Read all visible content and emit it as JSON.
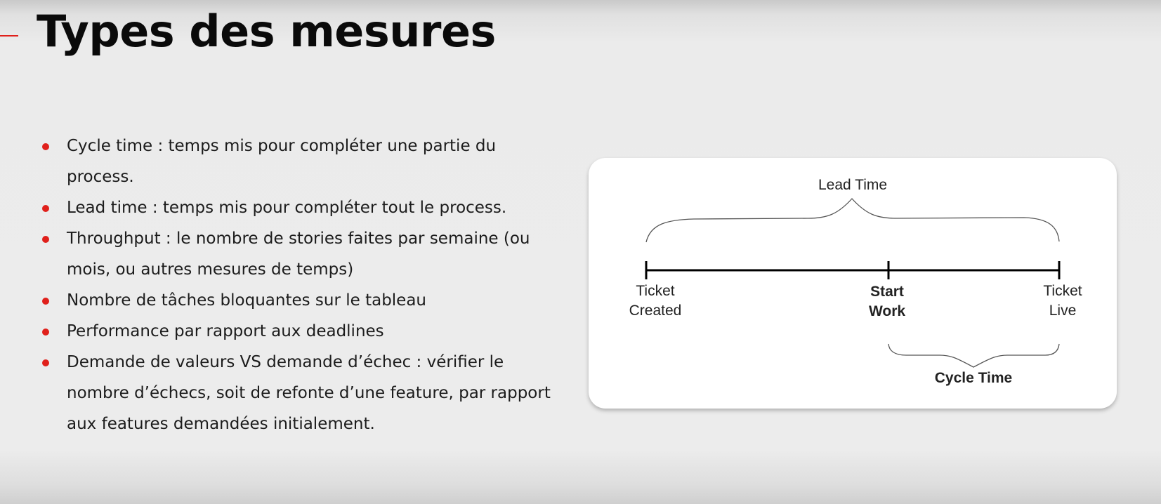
{
  "slide": {
    "title": "Types des mesures",
    "accent_color": "#e0201b"
  },
  "bullets": [
    "Cycle time : temps mis pour compléter une partie du process.",
    "Lead time : temps mis pour compléter tout le process.",
    "Throughput : le nombre de stories faites par semaine (ou mois, ou autres mesures de temps)",
    "Nombre de tâches bloquantes sur le tableau",
    "Performance par rapport aux deadlines",
    "Demande de valeurs VS demande d’échec : vérifier le nombre d’échecs, soit de refonte d’une feature, par rapport aux features demandées initialement."
  ],
  "diagram": {
    "lead_time_label": "Lead Time",
    "cycle_time_label": "Cycle Time",
    "ticket_created_line1": "Ticket",
    "ticket_created_line2": "Created",
    "start_work_line1": "Start",
    "start_work_line2": "Work",
    "ticket_live_line1": "Ticket",
    "ticket_live_line2": "Live"
  }
}
